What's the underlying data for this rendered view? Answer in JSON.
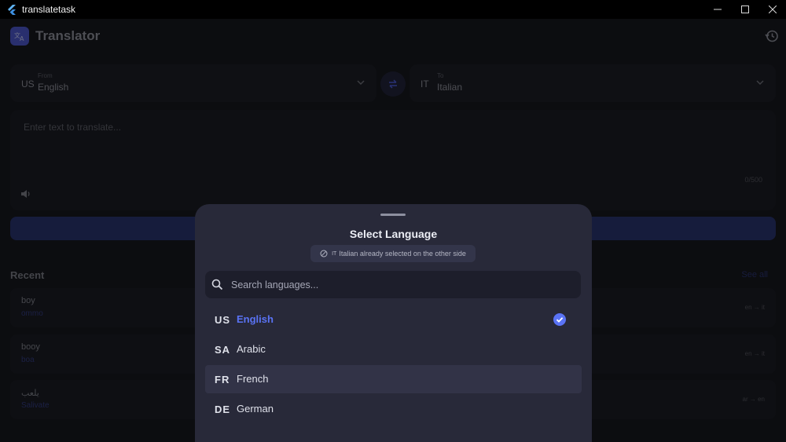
{
  "window": {
    "title": "translatetask",
    "controls": [
      "minimize",
      "maximize",
      "close"
    ]
  },
  "header": {
    "app_title": "Translator",
    "logo_icon": "translate-icon",
    "history_icon": "history-icon"
  },
  "languages": {
    "from": {
      "small_label": "From",
      "code": "US",
      "name": "English"
    },
    "to": {
      "small_label": "To",
      "code": "IT",
      "name": "Italian"
    },
    "swap_icon": "swap-icon"
  },
  "input": {
    "placeholder": "Enter text to translate...",
    "char_count": "0/500",
    "speaker_icon": "speaker-icon"
  },
  "recent": {
    "title": "Recent",
    "see_all": "See all",
    "items": [
      {
        "source": "boy",
        "translation": "ommo",
        "pair": "en → it"
      },
      {
        "source": "booy",
        "translation": "boa",
        "pair": "en → it"
      },
      {
        "source": "يلعب",
        "translation": "Salivate",
        "pair": "ar → en"
      }
    ]
  },
  "sheet": {
    "title": "Select Language",
    "note_code": "IT",
    "note_text": "Italian already selected on the other side",
    "search_placeholder": "Search languages...",
    "options": [
      {
        "code": "US",
        "name": "English",
        "selected": true
      },
      {
        "code": "SA",
        "name": "Arabic",
        "selected": false
      },
      {
        "code": "FR",
        "name": "French",
        "selected": false,
        "hovered": true
      },
      {
        "code": "DE",
        "name": "German",
        "selected": false
      }
    ]
  },
  "colors": {
    "accent": "#5a73f5",
    "sheet_bg": "#282939",
    "app_bg": "#17181e"
  }
}
